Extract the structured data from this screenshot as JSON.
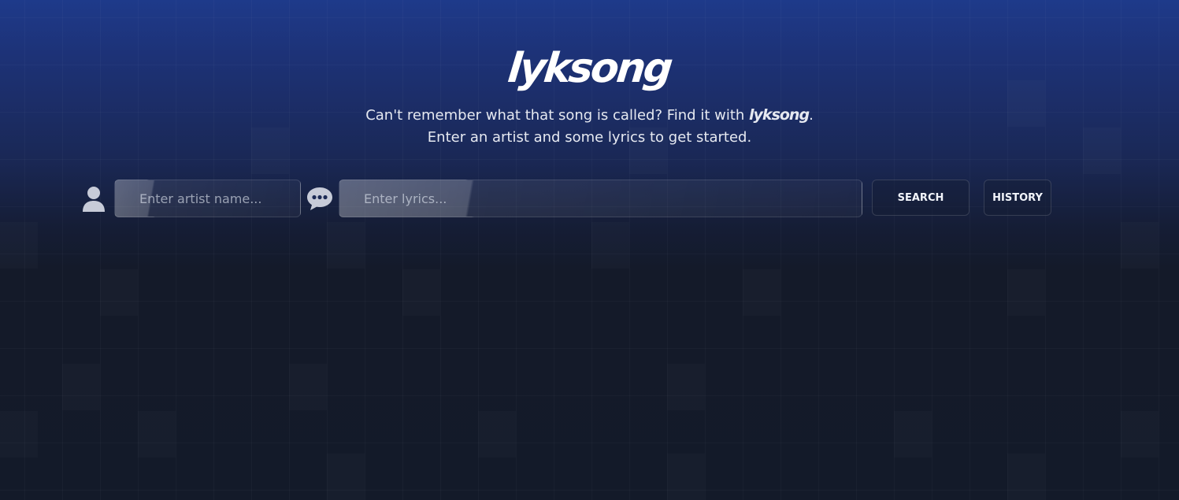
{
  "app": {
    "logo_text": "lyksong"
  },
  "hero": {
    "tagline_line1_prefix": "Can't remember what that song is called? Find it with ",
    "tagline_line1_logo": "lyksong",
    "tagline_line1_suffix": ".",
    "tagline_line2": "Enter an artist and some lyrics to get started."
  },
  "search": {
    "artist_placeholder": "Enter artist name...",
    "artist_value": "",
    "artist_icon": "user-icon",
    "lyrics_placeholder": "Enter lyrics...",
    "lyrics_value": "",
    "lyrics_icon": "chat-bubble-icon",
    "search_label": "SEARCH",
    "history_label": "HISTORY"
  },
  "colors": {
    "top_gradient": "#1e3a8a",
    "background": "#141a29",
    "text": "#e6e9f1",
    "icon": "#c7cbd8"
  }
}
